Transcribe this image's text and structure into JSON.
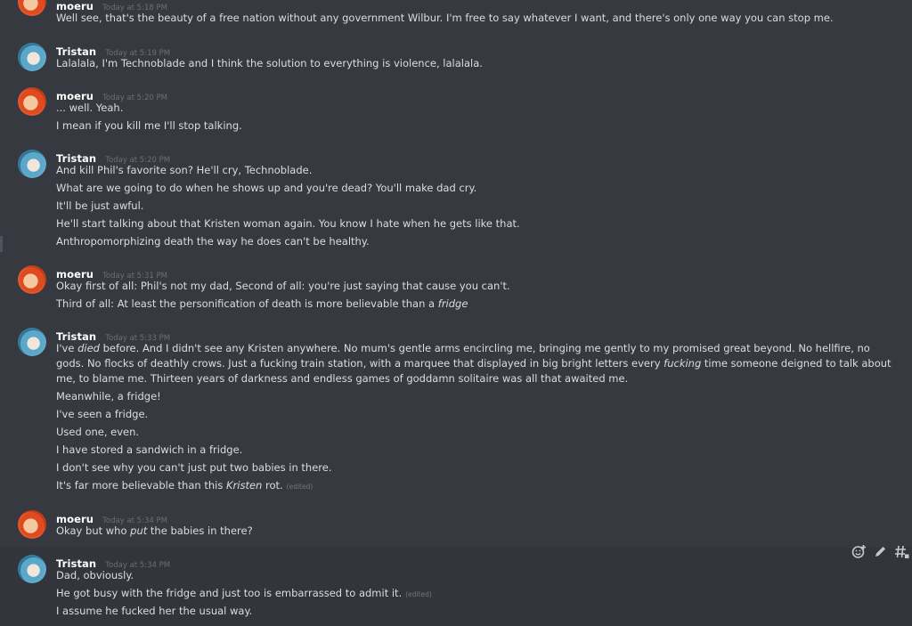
{
  "messages": [
    {
      "author": "moeru",
      "timestamp": "Today at 5:18 PM",
      "lines": [
        "Well see, that's the beauty of a free nation without any government Wilbur. I'm free to say whatever I want, and there's only one way you can stop me."
      ]
    },
    {
      "author": "Tristan",
      "timestamp": "Today at 5:19 PM",
      "lines": [
        "Lalalala, I'm Technoblade and I think the solution to everything is violence, lalalala."
      ]
    },
    {
      "author": "moeru",
      "timestamp": "Today at 5:20 PM",
      "lines": [
        "... well. Yeah.",
        "I mean if you kill me I'll stop talking."
      ]
    },
    {
      "author": "Tristan",
      "timestamp": "Today at 5:20 PM",
      "lines": [
        "And kill Phil's favorite son?  He'll cry, Technoblade.",
        "What are we going to do when he shows up and you're dead?  You'll make dad cry.",
        "It'll be just awful.",
        "He'll start talking about that Kristen woman again.  You know I hate when he gets like that.",
        "Anthropomorphizing death the way he does can't be healthy."
      ]
    },
    {
      "author": "moeru",
      "timestamp": "Today at 5:31 PM",
      "lines": [
        "Okay first of all: Phil's not my dad, Second of all: you're just saying that cause you can't.",
        "Third of all: At least the personification of death is more believable than a ",
        "fridge"
      ]
    },
    {
      "author": "Tristan",
      "timestamp": "Today at 5:33 PM",
      "lines": [
        "I've ",
        "died",
        " before.  And I didn't see any Kristen anywhere.  No mum's gentle arms encircling me, bringing me gently to my promised great beyond.  No hellfire, no gods.  No flocks of deathly crows.  Just a fucking train station, with a marquee that displayed in big bright letters every ",
        "fucking",
        " time someone deigned to talk about me, to blame me.  Thirteen years of darkness and endless games of goddamn solitaire was all that awaited me.",
        "Meanwhile, a fridge!",
        "I've seen a fridge.",
        "Used one, even.",
        "I have stored a sandwich in a fridge.",
        "I don't see why you can't just put two babies in there.",
        "It's far more believable than this ",
        "Kristen",
        " rot.",
        "(edited)"
      ]
    },
    {
      "author": "moeru",
      "timestamp": "Today at 5:34 PM",
      "lines": [
        "Okay but who ",
        "put",
        " the babies in there?"
      ]
    },
    {
      "author": "Tristan",
      "timestamp": "Today at 5:34 PM",
      "lines": [
        "Dad, obviously.",
        "He got busy with the fridge and just too is embarrassed to admit it.",
        "(edited)",
        "I assume he fucked her the usual way."
      ]
    }
  ],
  "toolbar": {
    "icons": [
      "add-reaction-icon",
      "edit-icon",
      "more-options-icon"
    ]
  },
  "colors": {
    "background": "#36393f",
    "hover_background": "#32353b",
    "username": "#ffffff",
    "message_text": "#dcddde",
    "timestamp": "#6c6f75"
  }
}
